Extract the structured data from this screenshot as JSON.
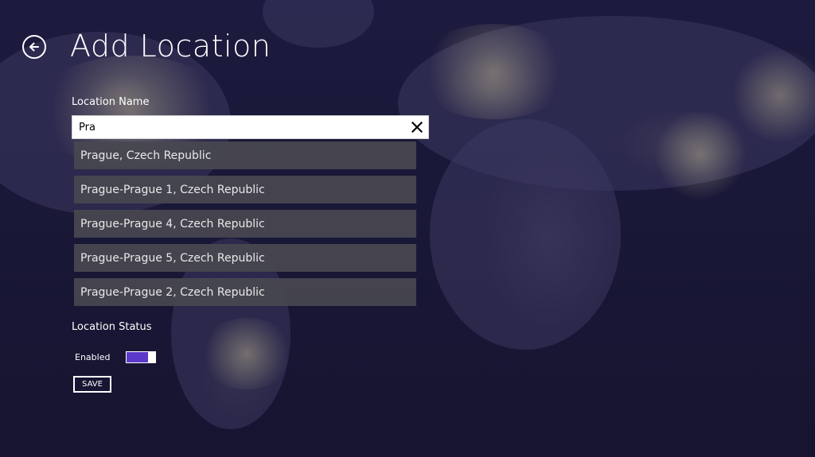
{
  "page": {
    "title": "Add Location",
    "back_icon": "back-arrow-icon"
  },
  "form": {
    "name_label": "Location Name",
    "search_value": "Pra",
    "clear_icon": "close-icon",
    "suggestions": [
      "Prague, Czech Republic",
      "Prague-Prague 1, Czech Republic",
      "Prague-Prague 4, Czech Republic",
      "Prague-Prague 5, Czech Republic",
      "Prague-Prague 2, Czech Republic"
    ],
    "status_label": "Location Status",
    "enabled_label": "Enabled",
    "toggle_on": true,
    "save_label": "SAVE"
  },
  "colors": {
    "background": "#1a1838",
    "toggle_accent": "#5b3acb",
    "suggestion_bg": "#48484f"
  }
}
